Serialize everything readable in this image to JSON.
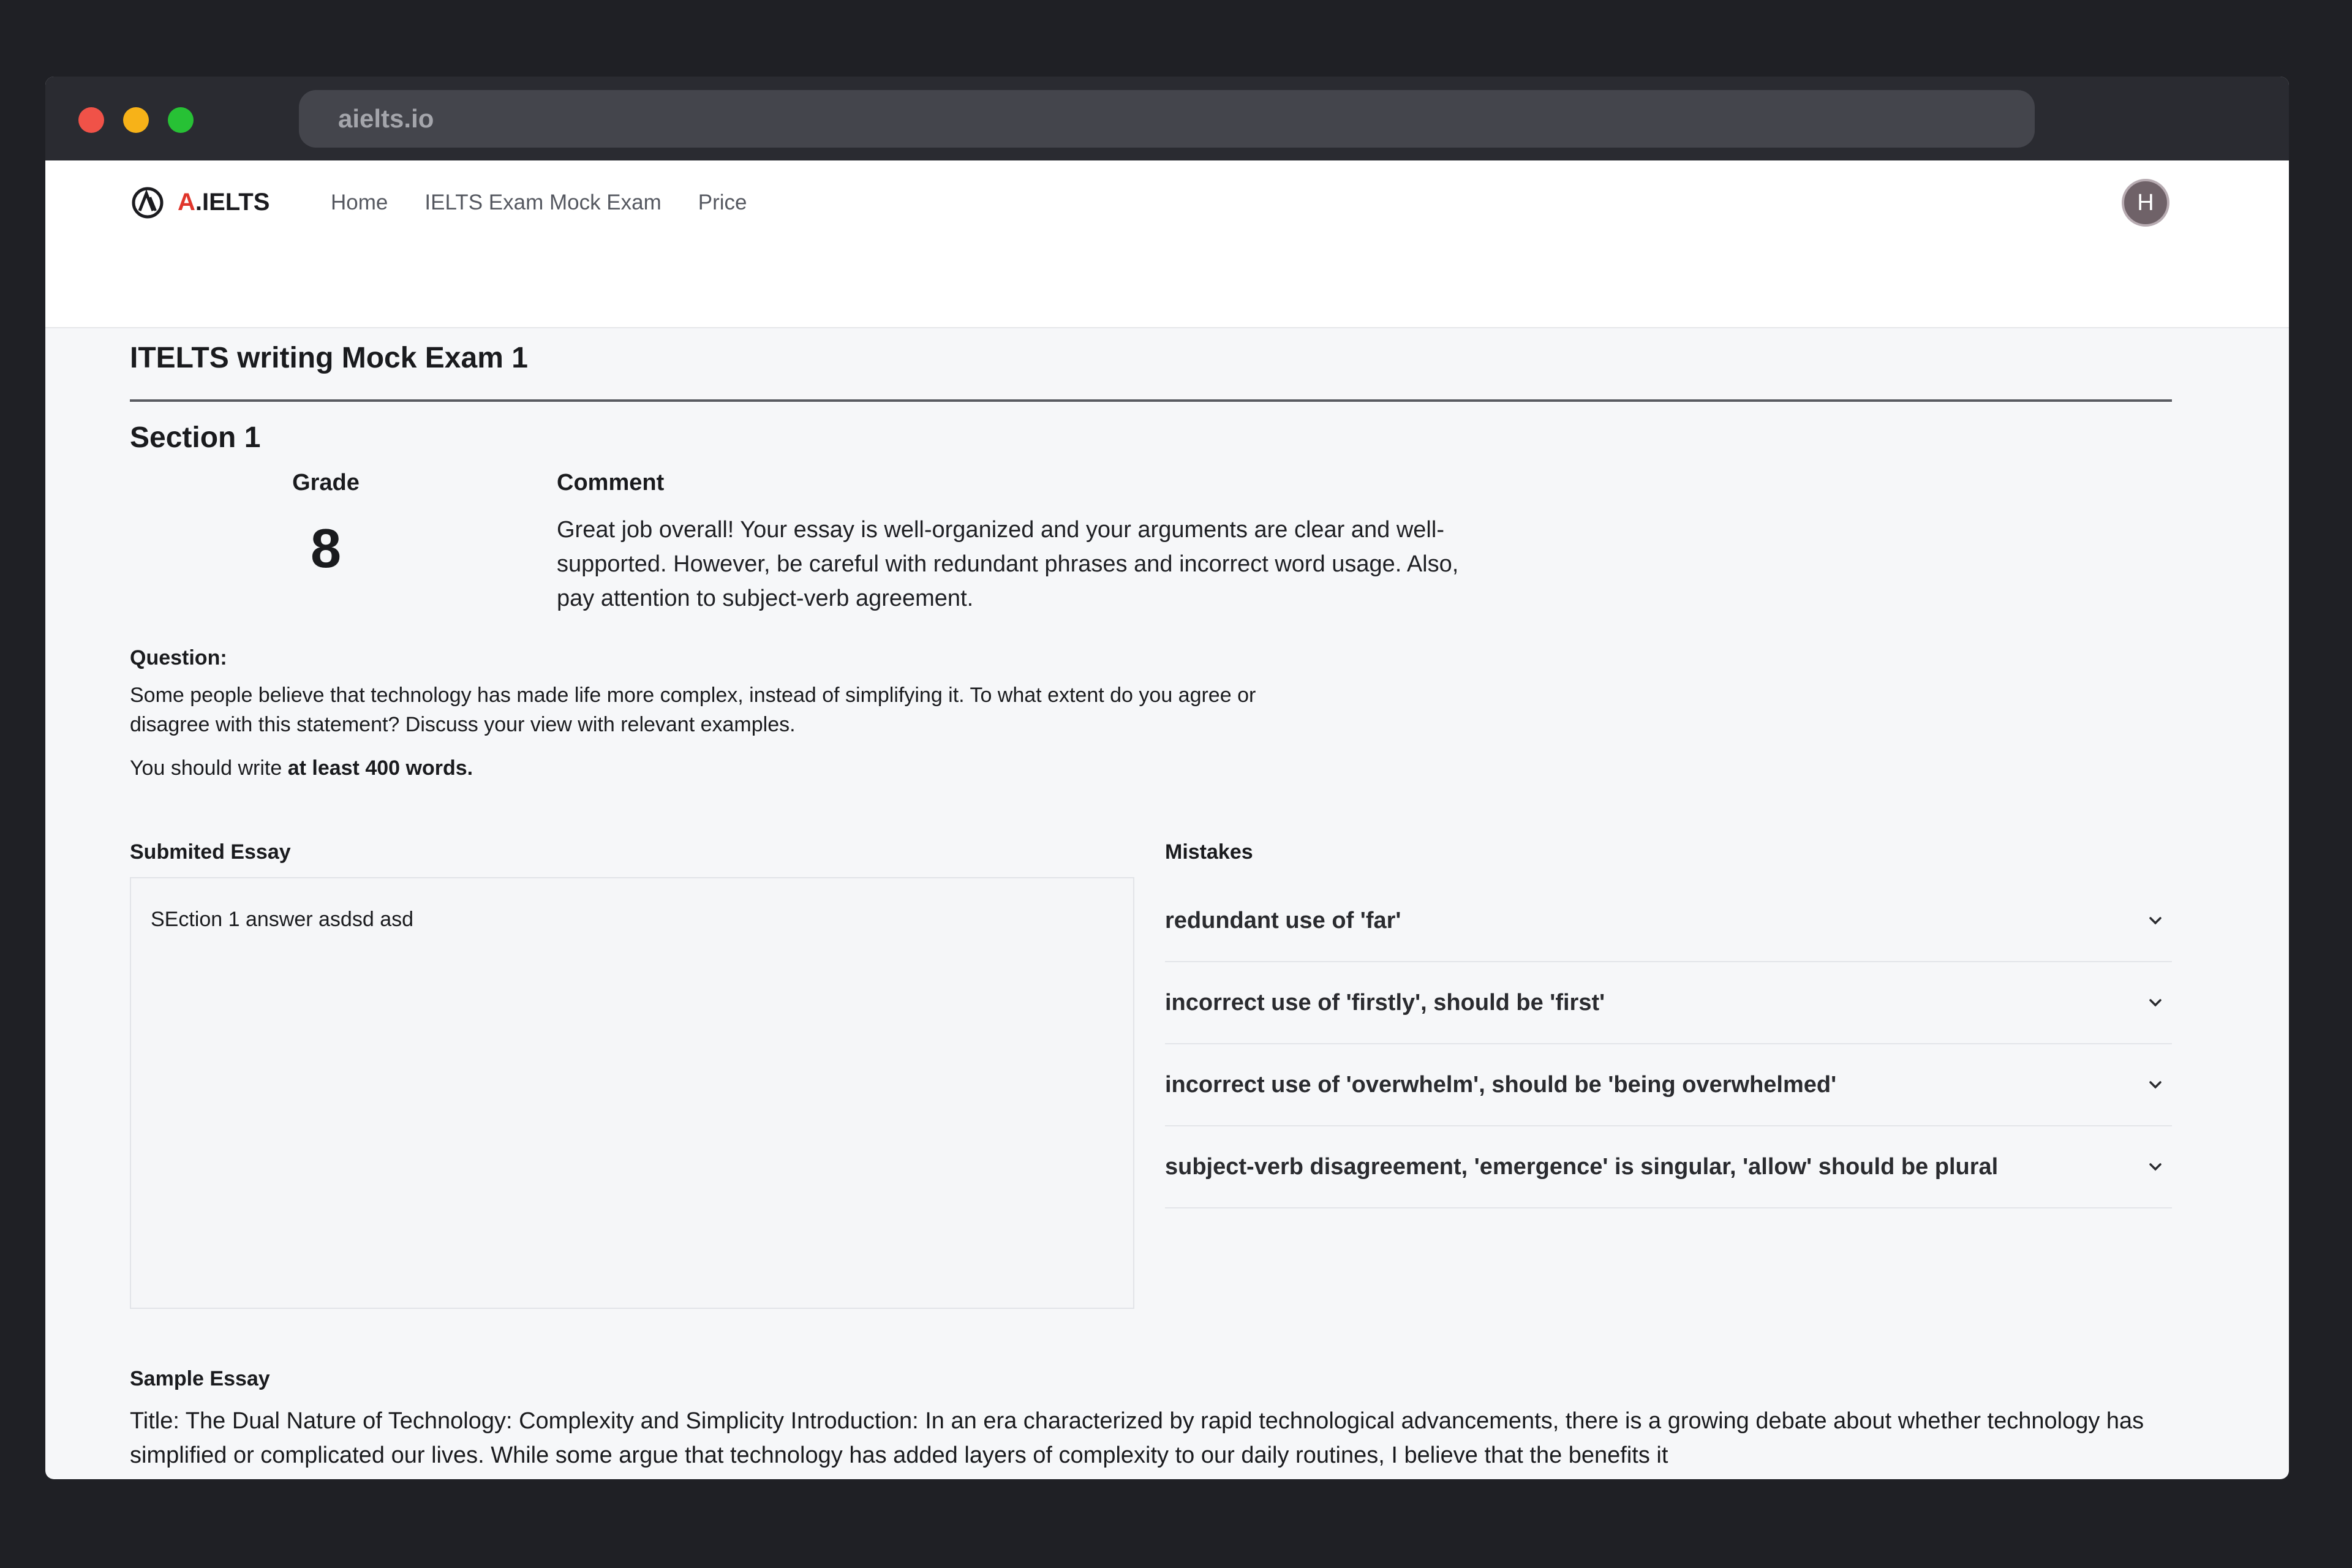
{
  "browser": {
    "url": "aielts.io"
  },
  "navbar": {
    "brand_prefix": "A",
    "brand_suffix": ".IELTS",
    "links": [
      "Home",
      "IELTS Exam Mock Exam",
      "Price"
    ],
    "avatar_initial": "H"
  },
  "page": {
    "title": "ITELTS writing Mock Exam 1"
  },
  "section": {
    "title": "Section 1",
    "grade_label": "Grade",
    "grade_value": "8",
    "comment_label": "Comment",
    "comment": "Great job overall! Your essay is well-organized and your arguments are clear and well-supported. However, be careful with redundant phrases and incorrect word usage. Also, pay attention to subject-verb agreement."
  },
  "question": {
    "label": "Question:",
    "text": "Some people believe that technology has made life more complex, instead of simplifying it. To what extent do you agree or disagree with this statement? Discuss your view with relevant examples.",
    "min_prefix": "You should write ",
    "min_bold": "at least 400 words."
  },
  "essay": {
    "label": "Submited Essay",
    "text": "SEction 1 answer asdsd asd"
  },
  "mistakes": {
    "label": "Mistakes",
    "items": [
      "redundant use of 'far'",
      "incorrect use of 'firstly', should be 'first'",
      "incorrect use of 'overwhelm', should be 'being overwhelmed'",
      "subject-verb disagreement, 'emergence' is singular, 'allow' should be plural"
    ]
  },
  "sample": {
    "label": "Sample Essay",
    "text": "Title: The Dual Nature of Technology: Complexity and Simplicity Introduction: In an era characterized by rapid technological advancements, there is a growing debate about whether technology has simplified or complicated our lives. While some argue that technology has added layers of complexity to our daily routines, I believe that the benefits it"
  },
  "colors": {
    "background": "#1f2025",
    "titlebar": "#2a2b31",
    "brand_accent": "#e0352b",
    "traffic_red": "#f05248",
    "traffic_yellow": "#f7b218",
    "traffic_green": "#27c135"
  }
}
